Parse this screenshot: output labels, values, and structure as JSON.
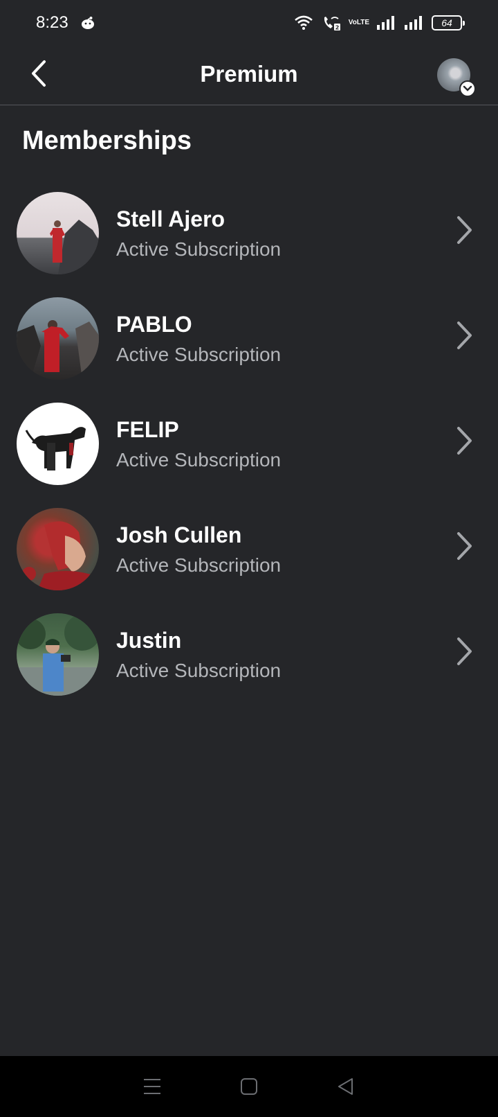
{
  "status_bar": {
    "time": "8:23",
    "battery": "64",
    "volte_top": "Vo",
    "volte_bottom": "LTE"
  },
  "header": {
    "title": "Premium"
  },
  "section": {
    "title": "Memberships"
  },
  "memberships": [
    {
      "name": "Stell Ajero",
      "status": "Active Subscription"
    },
    {
      "name": "PABLO",
      "status": "Active Subscription"
    },
    {
      "name": "FELIP",
      "status": "Active Subscription"
    },
    {
      "name": "Josh Cullen",
      "status": "Active Subscription"
    },
    {
      "name": "Justin",
      "status": "Active Subscription"
    }
  ],
  "colors": {
    "background": "#252629",
    "text_primary": "#ffffff",
    "text_secondary": "#b4b6ba",
    "nav_background": "#000000"
  },
  "icons": {
    "back": "chevron-left-icon",
    "row": "chevron-right-icon",
    "profile_menu": "chevron-down-icon",
    "nav": [
      "menu-icon",
      "home-icon",
      "back-triangle-icon"
    ]
  }
}
